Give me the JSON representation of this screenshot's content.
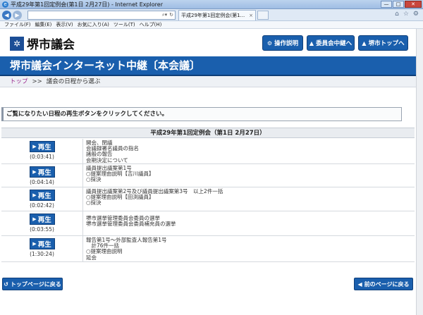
{
  "window": {
    "title": "平成29年第1回定例会(第1日 2月27日) - Internet Explorer",
    "controls": [
      "—",
      "□",
      "✕"
    ]
  },
  "browser": {
    "tab_title": "平成29年第1回定例会(第1...",
    "tab_close": "×",
    "menu": [
      "ファイル(F)",
      "編集(E)",
      "表示(V)",
      "お気に入り(A)",
      "ツール(T)",
      "ヘルプ(H)"
    ]
  },
  "header": {
    "logo_text": "堺市議会",
    "buttons": [
      {
        "icon": "⚙",
        "label": "操作説明"
      },
      {
        "icon": "▲",
        "label": "委員会中継へ"
      },
      {
        "icon": "▲",
        "label": "堺市トップへ"
      }
    ]
  },
  "banner": {
    "title": "堺市議会インターネット中継〔本会議〕"
  },
  "breadcrumb": {
    "top": "トップ",
    "sep": ">>",
    "current": "議会の日程から選ぶ"
  },
  "instruction": "ご覧になりたい日程の再生ボタンをクリックしてください。",
  "session_title": "平成29年第1回定例会（第1日 2月27日）",
  "play_label": "再生",
  "items": [
    {
      "duration": "(0:03:41)",
      "lines": [
        "開会、閉議",
        "会議録署名議員の指名",
        "諸般の報告",
        "会期決定について"
      ]
    },
    {
      "duration": "(0:04:14)",
      "lines": [
        "議員提出議案第1号",
        "○提案理由説明【吉川議員】",
        "○採決"
      ]
    },
    {
      "duration": "(0:02:42)",
      "lines": [
        "議員提出議案第2号及び議員提出議案第3号　以上2件一括",
        "○提案理由説明【田渕議員】",
        "○採決"
      ]
    },
    {
      "duration": "(0:03:55)",
      "lines": [
        "堺市選挙管理委員会委員の選挙",
        "堺市選挙管理委員会委員補充員の選挙"
      ]
    },
    {
      "duration": "(1:30:24)",
      "lines": [
        "報告第1号～外部監査人報告第1号",
        "　計76件一括",
        "○提案理由説明",
        "延会"
      ]
    }
  ],
  "footer": {
    "back_top": "トップページに戻る",
    "back_prev": "前のページに戻る"
  }
}
